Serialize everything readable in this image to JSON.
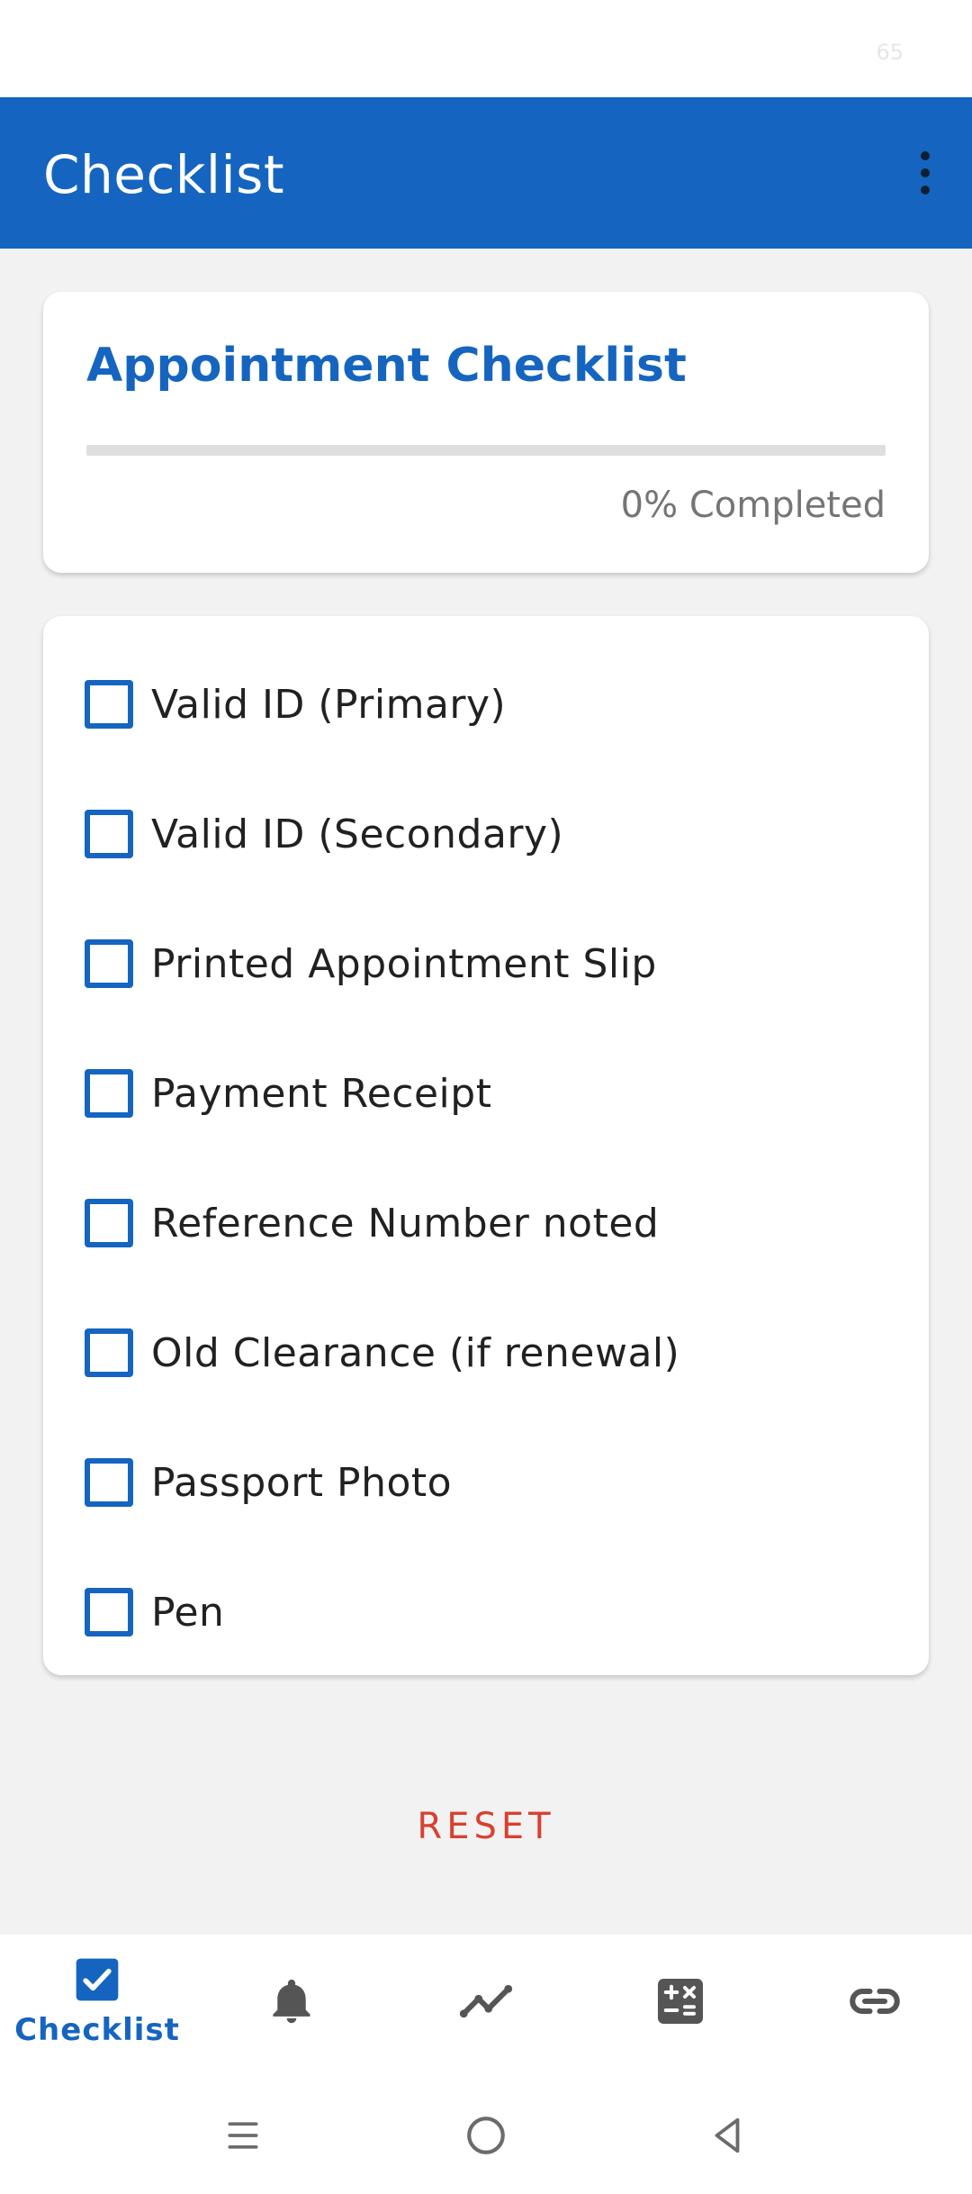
{
  "status_bar": {
    "number": "65"
  },
  "app_bar": {
    "title": "Checklist",
    "overflow_icon": "more-vert-icon"
  },
  "progress_card": {
    "title": "Appointment Checklist",
    "progress_fraction": 0,
    "progress_text": "0% Completed"
  },
  "checklist": {
    "items": [
      {
        "label": "Valid ID (Primary)",
        "checked": false
      },
      {
        "label": "Valid ID (Secondary)",
        "checked": false
      },
      {
        "label": "Printed Appointment Slip",
        "checked": false
      },
      {
        "label": "Payment Receipt",
        "checked": false
      },
      {
        "label": "Reference Number noted",
        "checked": false
      },
      {
        "label": "Old Clearance (if renewal)",
        "checked": false
      },
      {
        "label": "Passport Photo",
        "checked": false
      },
      {
        "label": "Pen",
        "checked": false
      }
    ]
  },
  "reset_label": "RESET",
  "bottom_nav": {
    "items": [
      {
        "label": "Checklist",
        "icon": "checkbox-icon",
        "active": true
      },
      {
        "label": "",
        "icon": "bell-icon",
        "active": false
      },
      {
        "label": "",
        "icon": "trend-line-icon",
        "active": false
      },
      {
        "label": "",
        "icon": "calculator-icon",
        "active": false
      },
      {
        "label": "",
        "icon": "link-icon",
        "active": false
      }
    ]
  },
  "colors": {
    "primary": "#1565c0",
    "reset": "#d84130",
    "inactive_icon": "#555555",
    "background": "#f2f2f2"
  },
  "system_nav": {
    "icons": [
      "menu-icon",
      "home-circle-icon",
      "back-triangle-icon"
    ]
  }
}
